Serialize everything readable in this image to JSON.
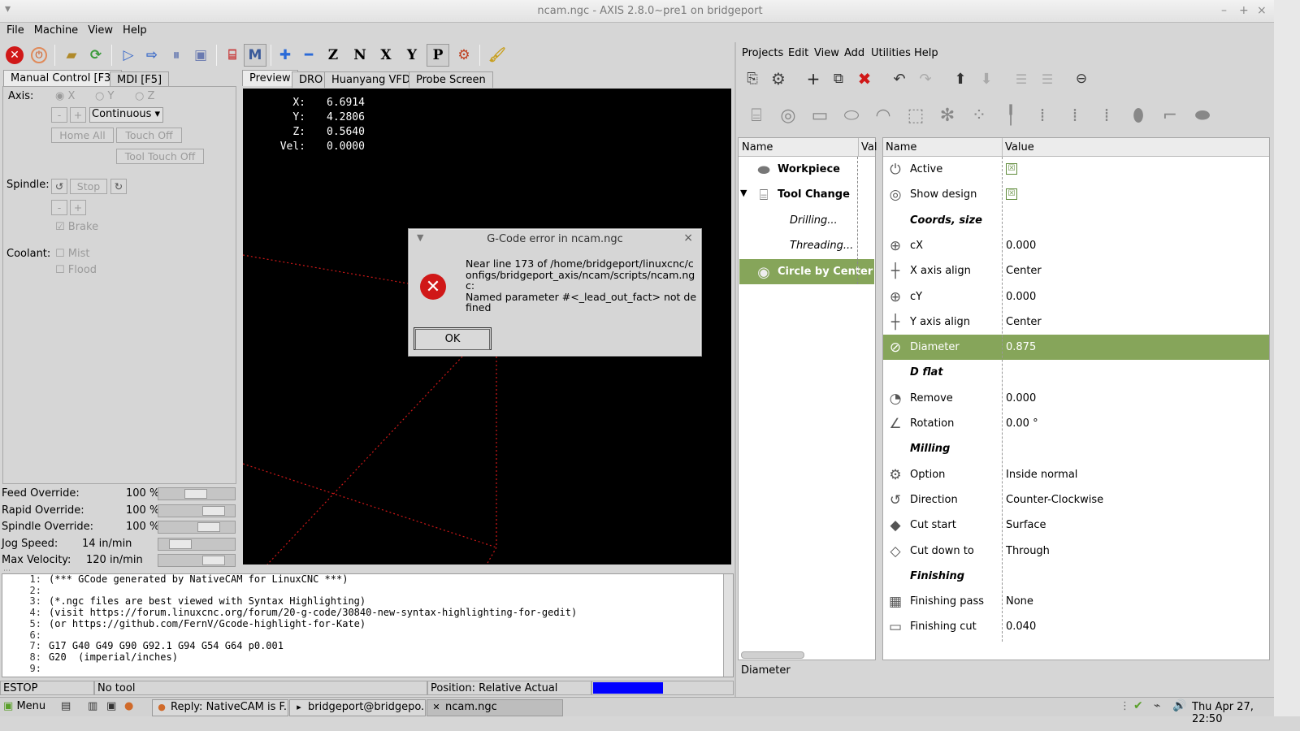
{
  "window": {
    "title": "ncam.ngc - AXIS 2.8.0~pre1 on bridgeport",
    "minimize": "–",
    "maximize": "+",
    "close": "×"
  },
  "menu": [
    "File",
    "Machine",
    "View",
    "Help"
  ],
  "tabs_left": [
    "Manual Control [F3]",
    "MDI [F5]"
  ],
  "tabs_preview": [
    "Preview",
    "DRO",
    "Huanyang VFD",
    "Probe Screen"
  ],
  "manual": {
    "axis_label": "Axis:",
    "axes": [
      "X",
      "Y",
      "Z"
    ],
    "minus": "-",
    "plus": "+",
    "jog_mode": "Continuous",
    "home_all": "Home All",
    "touch_off": "Touch Off",
    "tool_touch_off": "Tool Touch Off",
    "spindle_label": "Spindle:",
    "stop": "Stop",
    "brake": "Brake",
    "coolant_label": "Coolant:",
    "mist": "Mist",
    "flood": "Flood"
  },
  "overrides": [
    {
      "label": "Feed Override:",
      "value": "100 %",
      "level": 0.5
    },
    {
      "label": "Rapid Override:",
      "value": "100 %",
      "level": 0.85
    },
    {
      "label": "Spindle Override:",
      "value": "100 %",
      "level": 0.75
    },
    {
      "label": "Jog Speed:",
      "value": "14 in/min",
      "level": 0.2
    },
    {
      "label": "Max Velocity:",
      "value": "120 in/min",
      "level": 0.85
    }
  ],
  "dro": [
    {
      "k": "X:",
      "v": "6.6914"
    },
    {
      "k": "Y:",
      "v": "4.2806"
    },
    {
      "k": "Z:",
      "v": "0.5640"
    },
    {
      "k": "Vel:",
      "v": "0.0000"
    }
  ],
  "gcode": [
    {
      "n": "1:",
      "t": "(*** GCode generated by NativeCAM for LinuxCNC ***)"
    },
    {
      "n": "2:",
      "t": ""
    },
    {
      "n": "3:",
      "t": "(*.ngc files are best viewed with Syntax Highlighting)"
    },
    {
      "n": "4:",
      "t": "(visit https://forum.linuxcnc.org/forum/20-g-code/30840-new-syntax-highlighting-for-gedit)"
    },
    {
      "n": "5:",
      "t": "(or https://github.com/FernV/Gcode-highlight-for-Kate)"
    },
    {
      "n": "6:",
      "t": ""
    },
    {
      "n": "7:",
      "t": "G17 G40 G49 G90 G92.1 G94 G54 G64 p0.001"
    },
    {
      "n": "8:",
      "t": "G20  (imperial/inches)"
    },
    {
      "n": "9:",
      "t": ""
    }
  ],
  "status": {
    "estop": "ESTOP",
    "tool": "No tool",
    "position": "Position: Relative Actual"
  },
  "dialog": {
    "title": "G-Code error in ncam.ngc",
    "message": "Near line 173 of /home/bridgeport/linuxcnc/configs/bridgeport_axis/ncam/scripts/ncam.ngc:\nNamed parameter #<_lead_out_fact> not defined",
    "ok": "OK"
  },
  "ncam": {
    "menu": [
      "Projects",
      "Edit",
      "View",
      "Add",
      "Utilities",
      "Help"
    ],
    "tree_headers": [
      "Name",
      "Val"
    ],
    "tree": [
      {
        "label": "Workpiece",
        "bold": true,
        "icon": "workpiece-icon"
      },
      {
        "label": "Tool Change",
        "bold": true,
        "icon": "tool-change-icon"
      },
      {
        "label": "Drilling...",
        "italic": true
      },
      {
        "label": "Threading...",
        "italic": true
      },
      {
        "label": "Circle by Center",
        "bold": true,
        "icon": "circle-icon",
        "selected": true
      }
    ],
    "prop_headers": [
      "Name",
      "Value"
    ],
    "props": [
      {
        "name": "Active",
        "value": "☒",
        "check": true,
        "icon": "⏻"
      },
      {
        "name": "Show design",
        "value": "☒",
        "check": true,
        "icon": "◎"
      },
      {
        "name": "Coords, size",
        "header": true
      },
      {
        "name": "cX",
        "value": "0.000",
        "icon": "⊕"
      },
      {
        "name": "X axis align",
        "value": "Center",
        "icon": "┼"
      },
      {
        "name": "cY",
        "value": "0.000",
        "icon": "⊕"
      },
      {
        "name": "Y axis align",
        "value": "Center",
        "icon": "┼"
      },
      {
        "name": "Diameter",
        "value": "0.875",
        "icon": "⊘",
        "selected": true
      },
      {
        "name": "D flat",
        "header": true
      },
      {
        "name": "Remove",
        "value": "0.000",
        "icon": "◔"
      },
      {
        "name": "Rotation",
        "value": "0.00 °",
        "icon": "∠"
      },
      {
        "name": "Milling",
        "header": true
      },
      {
        "name": "Option",
        "value": "Inside normal",
        "icon": "⚙"
      },
      {
        "name": "Direction",
        "value": "Counter-Clockwise",
        "icon": "↺"
      },
      {
        "name": "Cut start",
        "value": "Surface",
        "icon": "◆"
      },
      {
        "name": "Cut down to",
        "value": "Through",
        "icon": "◇"
      },
      {
        "name": "Finishing",
        "header": true
      },
      {
        "name": "Finishing pass",
        "value": "None",
        "icon": "▦"
      },
      {
        "name": "Finishing cut",
        "value": "0.040",
        "icon": "▭"
      }
    ],
    "status": "Diameter"
  },
  "taskbar": {
    "menu": "Menu",
    "tasks": [
      "Reply: NativeCAM is F...",
      "bridgeport@bridgepo...",
      "ncam.ngc"
    ],
    "clock": "Thu Apr 27, 22:50"
  },
  "colors": {
    "accent": "#86a55a",
    "progress": "#0000ff",
    "preview_bg": "#000000"
  }
}
